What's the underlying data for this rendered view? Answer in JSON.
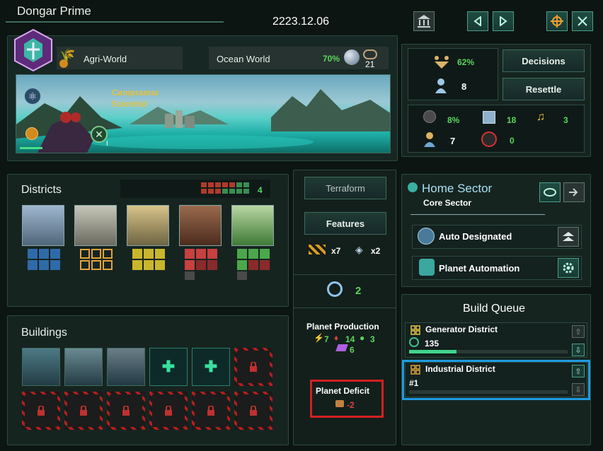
{
  "planet": {
    "name": "Dongar Prime",
    "date": "2223.12.06",
    "designation": "Agri-World",
    "type": "Ocean World",
    "habitability": "70%",
    "size": "21",
    "leader_name": "Campramar",
    "leader_role": "Scientist",
    "leader_level": "I"
  },
  "stats": {
    "stability": "62%",
    "pops": "8",
    "crime": "8%",
    "housing": "18",
    "amenities": "3",
    "jobs": "7",
    "unemployed": "0"
  },
  "buttons": {
    "decisions": "Decisions",
    "resettle": "Resettle",
    "terraform": "Terraform",
    "features": "Features"
  },
  "districts": {
    "title": "Districts",
    "count": "4"
  },
  "features": {
    "blocker_count": "x7",
    "feature_count": "x2"
  },
  "moons": "2",
  "buildings": {
    "title": "Buildings"
  },
  "production": {
    "title": "Planet Production",
    "energy": "7",
    "minerals": "14",
    "food": "3",
    "alloys": "6"
  },
  "deficit": {
    "title": "Planet Deficit",
    "value": "-2"
  },
  "sector": {
    "title": "Home Sector",
    "subtitle": "Core Sector",
    "auto_designated": "Auto Designated",
    "planet_automation": "Planet Automation"
  },
  "build_queue": {
    "title": "Build Queue",
    "items": [
      {
        "name": "Generator District",
        "detail": "135",
        "progress": 0.3
      },
      {
        "name": "Industrial District",
        "detail": "#1",
        "progress": 0
      }
    ]
  },
  "colors": {
    "accent_green": "#5cd65c",
    "highlight_red": "#d32020",
    "highlight_blue": "#1e9be0",
    "leader_gold": "#e3c23c"
  }
}
